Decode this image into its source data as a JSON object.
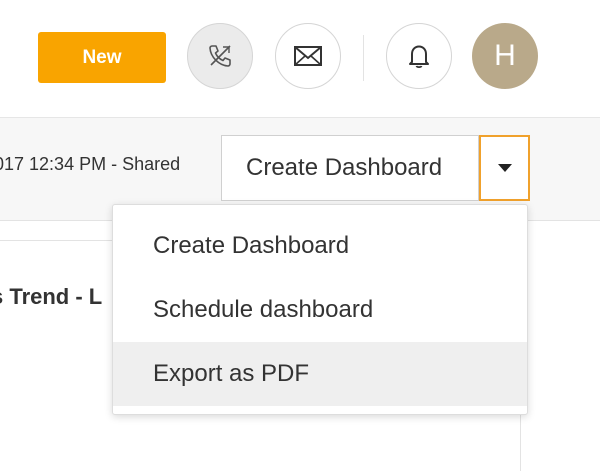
{
  "header": {
    "new_label": "New",
    "phone_icon": "phone-off-icon",
    "mail_icon": "mail-icon",
    "bell_icon": "bell-icon",
    "avatar_initial": "H",
    "accent_color": "#f9a400",
    "avatar_color": "#b9a98a"
  },
  "toolbar": {
    "shared_text": "017 12:34 PM - Shared",
    "create_dashboard_label": "Create Dashboard",
    "caret_icon": "caret-down-icon",
    "caret_border_color": "#f0a12c"
  },
  "content": {
    "widget_title": "s Trend - L"
  },
  "dropdown": {
    "items": [
      {
        "label": "Create Dashboard"
      },
      {
        "label": "Schedule dashboard"
      },
      {
        "label": "Export as PDF",
        "highlighted": true
      }
    ]
  }
}
